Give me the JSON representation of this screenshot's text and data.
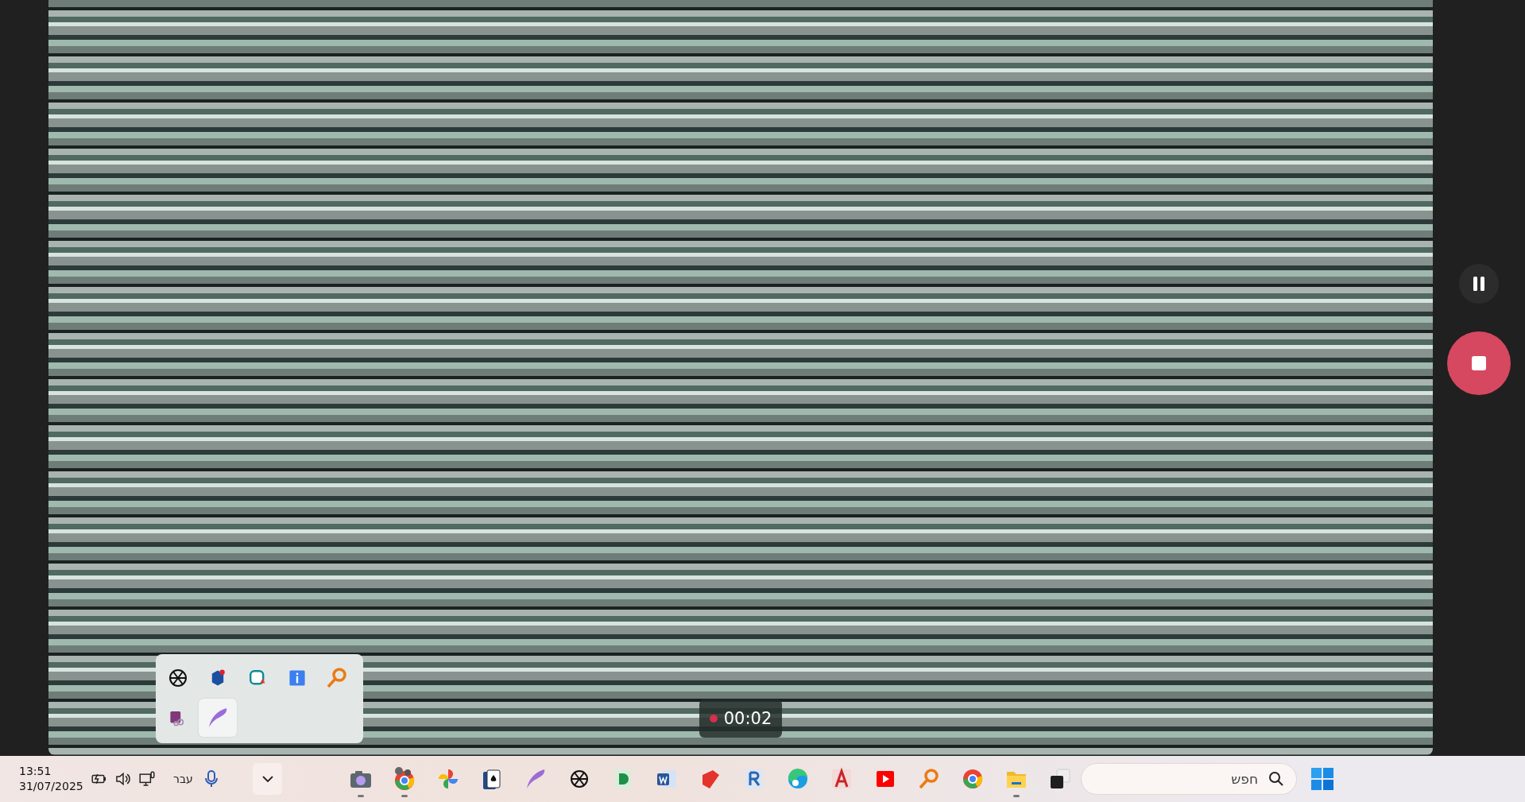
{
  "recording": {
    "timer": "00:02",
    "recording": true
  },
  "controls": [
    {
      "kind": "pause"
    },
    {
      "kind": "stop"
    }
  ],
  "tray_popup": [
    {
      "kind": "openai",
      "selected": false
    },
    {
      "kind": "remote",
      "selected": false
    },
    {
      "kind": "antivirus",
      "selected": false
    },
    {
      "kind": "info",
      "selected": false
    },
    {
      "kind": "key",
      "selected": false
    },
    {
      "kind": "clipper",
      "selected": false
    },
    {
      "kind": "feather",
      "selected": true
    }
  ],
  "taskbar": {
    "clock": {
      "time": "13:51",
      "date": "31/07/2025"
    },
    "tray": [
      {
        "kind": "battery"
      },
      {
        "kind": "volume"
      },
      {
        "kind": "network"
      }
    ],
    "language": "עבר",
    "apps": [
      {
        "kind": "camera",
        "running": true
      },
      {
        "kind": "chrome-profile",
        "running": true
      },
      {
        "kind": "photos",
        "running": false
      },
      {
        "kind": "cards",
        "running": false
      },
      {
        "kind": "feather",
        "running": false
      },
      {
        "kind": "openai",
        "running": false
      },
      {
        "kind": "green-doc",
        "running": false
      },
      {
        "kind": "word",
        "running": false
      },
      {
        "kind": "sketch",
        "running": false
      },
      {
        "kind": "revit",
        "running": false
      },
      {
        "kind": "edge",
        "running": false
      },
      {
        "kind": "cad",
        "running": false
      },
      {
        "kind": "youtube",
        "running": false
      },
      {
        "kind": "key",
        "running": false
      },
      {
        "kind": "chrome",
        "running": false
      },
      {
        "kind": "folder",
        "running": true
      },
      {
        "kind": "taskview",
        "running": false
      }
    ],
    "search": {
      "placeholder": "חפש"
    }
  }
}
